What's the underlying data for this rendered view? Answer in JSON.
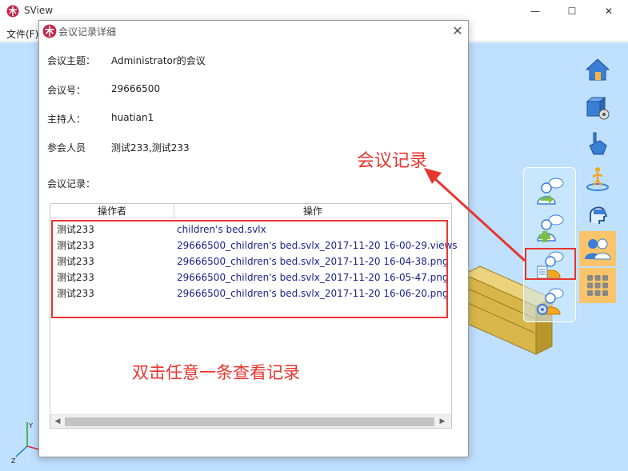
{
  "app": {
    "title": "SView",
    "menu_file": "文件(F)",
    "controls": {
      "minimize": "—",
      "maximize": "☐",
      "close": "✕"
    }
  },
  "dialog": {
    "title": "会议记录详细",
    "close": "✕",
    "fields": [
      {
        "label": "会议主题：",
        "value": "Administrator的会议"
      },
      {
        "label": "会议号：",
        "value": "29666500"
      },
      {
        "label": "主持人：",
        "value": "huatian1"
      },
      {
        "label": "参会人员",
        "value": "测试233,测试233"
      }
    ],
    "records_label": "会议记录：",
    "table": {
      "headers": [
        "操作者",
        "操作"
      ],
      "rows": [
        {
          "operator": "测试233",
          "action": "children's bed.svlx"
        },
        {
          "operator": "测试233",
          "action": "29666500_children's bed.svlx_2017-11-20 16-00-29.views"
        },
        {
          "operator": "测试233",
          "action": "29666500_children's bed.svlx_2017-11-20 16-04-38.png"
        },
        {
          "operator": "测试233",
          "action": "29666500_children's bed.svlx_2017-11-20 16-05-47.png"
        },
        {
          "operator": "测试233",
          "action": "29666500_children's bed.svlx_2017-11-20 16-06-20.png"
        }
      ],
      "scroll_left": "◀",
      "scroll_right": "▶"
    }
  },
  "annotations": {
    "meeting_record": "会议记录",
    "double_click": "双击任意一条查看记录"
  },
  "viewport": {
    "axis_y": "Y",
    "axis_z": "Z"
  },
  "colors": {
    "viewport_bg": "#bfe0ff",
    "annotation_red": "#e8352f",
    "link_blue": "#1a1f8a",
    "active_tool": "#f9c46a"
  },
  "side_toolbar_icons": [
    "home-icon",
    "cube-settings-icon",
    "hand-pointer-icon",
    "walk-person-icon",
    "head-view-icon",
    "meeting-users-icon",
    "grid-apps-icon"
  ],
  "meeting_panel_icons": [
    "join-meeting-icon",
    "create-meeting-icon",
    "meeting-record-icon",
    "meeting-settings-icon"
  ]
}
